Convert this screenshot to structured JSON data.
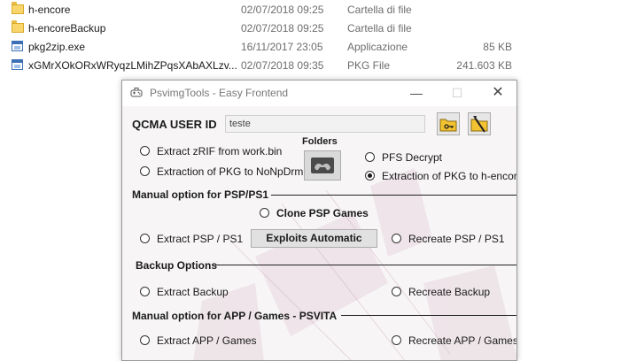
{
  "explorer": {
    "files": [
      {
        "name": "h-encore",
        "date": "02/07/2018 09:25",
        "type": "Cartella di file",
        "size": "",
        "icon": "folder-icon"
      },
      {
        "name": "h-encoreBackup",
        "date": "02/07/2018 09:25",
        "type": "Cartella di file",
        "size": "",
        "icon": "folder-icon"
      },
      {
        "name": "pkg2zip.exe",
        "date": "16/11/2017 23:05",
        "type": "Applicazione",
        "size": "85 KB",
        "icon": "application-icon"
      },
      {
        "name": "xGMrXOkORxWRyqzLMihZPqsXAbAXLzv...",
        "date": "02/07/2018 09:35",
        "type": "PKG File",
        "size": "241.603 KB",
        "icon": "application-icon"
      }
    ]
  },
  "window": {
    "title": "PsvimgTools - Easy Frontend",
    "minimize": "—",
    "maximize": "☐",
    "close": "✕",
    "qcma_label": "QCMA USER ID",
    "user_id_value": "teste",
    "folders_label": "Folders",
    "options": {
      "extract_zrif": "Extract zRIF from work.bin",
      "extract_pkg_nonpdrm": "Extraction of PKG to NoNpDrm",
      "pfs_decrypt": "PFS Decrypt",
      "extract_pkg_hencore": "Extraction of PKG to h-encore"
    },
    "psp_section": {
      "title": "Manual option for PSP/PS1",
      "clone": "Clone PSP Games",
      "extract": "Extract PSP / PS1",
      "exploits_button": "Exploits Automatic",
      "recreate": "Recreate PSP / PS1"
    },
    "backup_section": {
      "title": "Backup Options",
      "extract": "Extract Backup",
      "recreate": "Recreate Backup"
    },
    "app_section": {
      "title": "Manual option for APP / Games - PSVITA",
      "extract": "Extract APP / Games",
      "recreate": "Recreate APP / Games"
    },
    "selected_option": "extract_pkg_hencore"
  },
  "colors": {
    "folder": "#f8d66b",
    "app_accent": "#3b6fb6",
    "window_bg": "#f7f5f6",
    "icon_button_yellow": "#f2c230"
  }
}
